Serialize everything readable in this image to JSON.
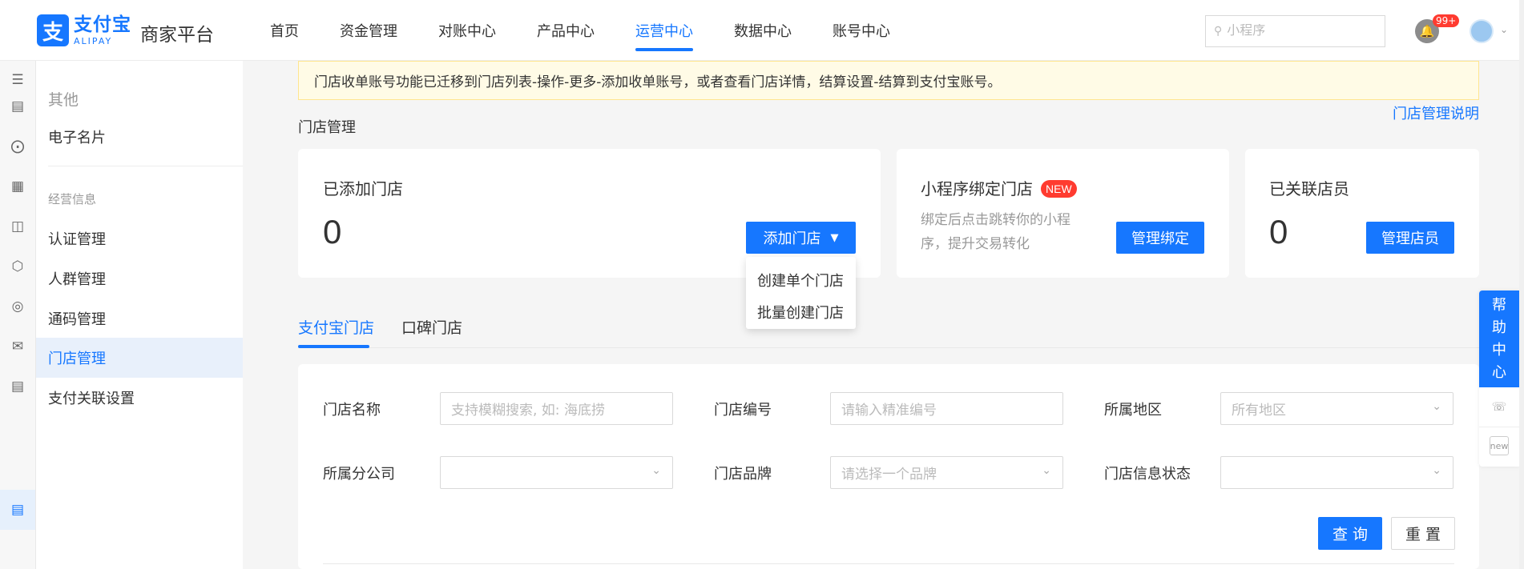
{
  "header": {
    "logo_mark": "支",
    "logo_cn": "支付宝",
    "logo_en": "ALIPAY",
    "platform_name": "商家平台",
    "nav": [
      "首页",
      "资金管理",
      "对账中心",
      "产品中心",
      "运营中心",
      "数据中心",
      "账号中心"
    ],
    "active_nav": "运营中心",
    "search_placeholder": "小程序",
    "notification_badge": "99+"
  },
  "rail": {
    "icons": [
      "menu-icon",
      "chart-icon",
      "compass-icon",
      "receipt-icon",
      "gift-icon",
      "cube-icon",
      "badge-icon",
      "mail-icon",
      "doc-icon",
      "doc-active-icon"
    ]
  },
  "sidemenu": {
    "section_other": "其他",
    "item_card": "电子名片",
    "group_title": "经营信息",
    "items": [
      "认证管理",
      "人群管理",
      "通码管理",
      "门店管理",
      "支付关联设置"
    ],
    "active_item": "门店管理"
  },
  "notice": "门店收单账号功能已迁移到门店列表-操作-更多-添加收单账号，或者查看门店详情，结算设置-结算到支付宝账号。",
  "page": {
    "title": "门店管理",
    "help_link": "门店管理说明"
  },
  "cards": {
    "stores": {
      "title": "已添加门店",
      "value": "0",
      "button": "添加门店"
    },
    "miniapp": {
      "title": "小程序绑定门店",
      "badge": "NEW",
      "desc": "绑定后点击跳转你的小程序，提升交易转化",
      "button": "管理绑定"
    },
    "staff": {
      "title": "已关联店员",
      "value": "0",
      "button": "管理店员"
    }
  },
  "dropdown": [
    "创建单个门店",
    "批量创建门店"
  ],
  "tabs": [
    "支付宝门店",
    "口碑门店"
  ],
  "filters": {
    "store_name": {
      "label": "门店名称",
      "placeholder": "支持模糊搜索, 如: 海底捞"
    },
    "store_no": {
      "label": "门店编号",
      "placeholder": "请输入精准编号"
    },
    "region": {
      "label": "所属地区",
      "placeholder": "所有地区"
    },
    "branch": {
      "label": "所属分公司",
      "placeholder": ""
    },
    "brand": {
      "label": "门店品牌",
      "placeholder": "请选择一个品牌"
    },
    "status": {
      "label": "门店信息状态",
      "placeholder": ""
    },
    "query_button": "查 询",
    "reset_button": "重 置"
  },
  "help_float": {
    "chars": [
      "帮",
      "助",
      "中",
      "心"
    ],
    "new_label": "new"
  },
  "colors": {
    "accent": "#1677ff",
    "notice_bg": "#fffbe6",
    "badge": "#ff3b30"
  }
}
